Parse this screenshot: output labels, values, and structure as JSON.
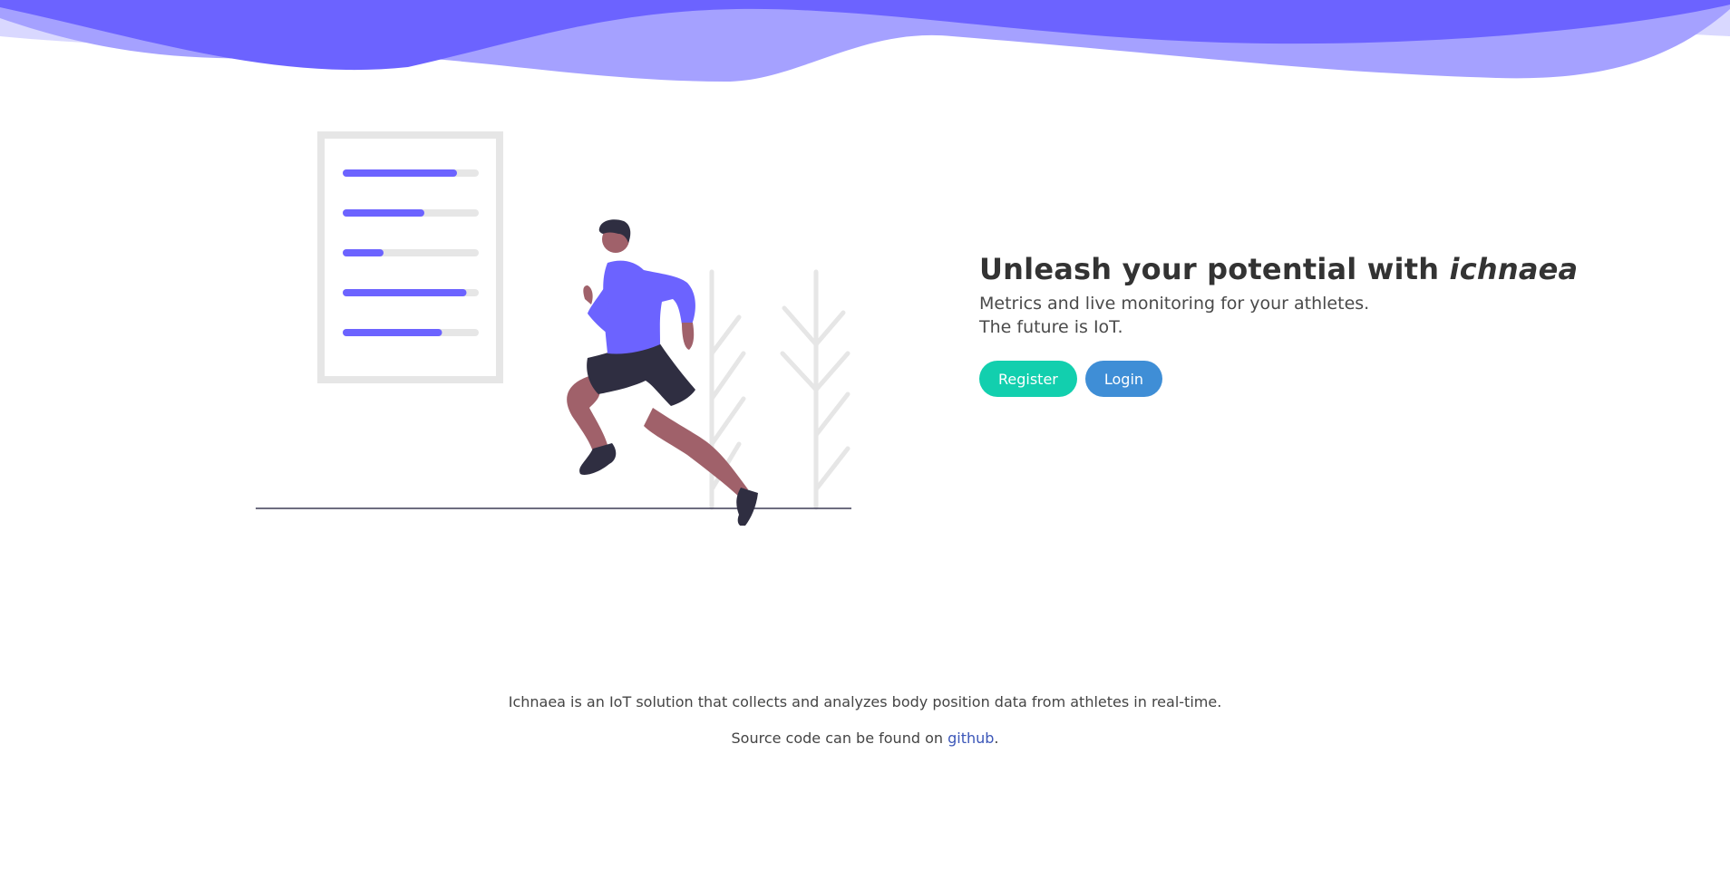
{
  "hero": {
    "title_prefix": "Unleash your potential with ",
    "title_brand": "ichnaea",
    "subtitle_line1": "Metrics and live monitoring for your athletes.",
    "subtitle_line2": "The future is IoT.",
    "register_label": "Register",
    "login_label": "Login"
  },
  "footer": {
    "description": "Ichnaea is an IoT solution that collects and analyzes body position data from athletes in real-time.",
    "source_prefix": "Source code can be found on ",
    "source_link_label": "github",
    "source_suffix": "."
  },
  "illustration": {
    "progress_levels": [
      0.84,
      0.6,
      0.3,
      0.91,
      0.73
    ]
  },
  "colors": {
    "accent": "#6c63ff",
    "register": "#12cfae",
    "login": "#3f8ed6",
    "link": "#3b56b8",
    "skin": "#a0616a",
    "dark": "#2f2e41",
    "light_gray": "#e6e6e6"
  }
}
